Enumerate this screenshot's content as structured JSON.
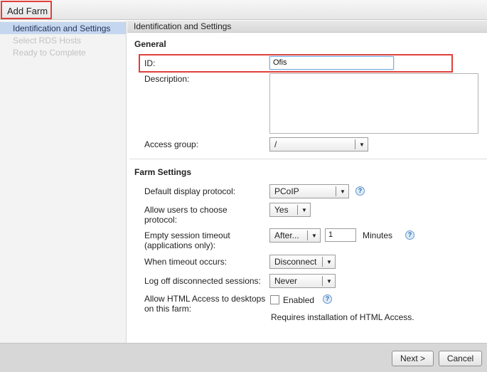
{
  "window": {
    "title": "Add Farm"
  },
  "sidebar": {
    "steps": [
      {
        "label": "Identification and Settings"
      },
      {
        "label": "Select RDS Hosts"
      },
      {
        "label": "Ready to Complete"
      }
    ]
  },
  "panel": {
    "header": "Identification and Settings"
  },
  "general": {
    "title": "General",
    "id_label": "ID:",
    "id_value": "Ofis",
    "description_label": "Description:",
    "access_group_label": "Access group:",
    "access_group_value": "/"
  },
  "farm_settings": {
    "title": "Farm Settings",
    "display_protocol_label": "Default display protocol:",
    "display_protocol_value": "PCoIP",
    "allow_choose_label_line1": "Allow users to choose",
    "allow_choose_label_line2": "protocol:",
    "allow_choose_value": "Yes",
    "empty_timeout_label_line1": "Empty session timeout",
    "empty_timeout_label_line2": "(applications only):",
    "empty_timeout_mode": "After...",
    "empty_timeout_value": "1",
    "empty_timeout_unit": "Minutes",
    "when_timeout_label": "When timeout occurs:",
    "when_timeout_value": "Disconnect",
    "logoff_label": "Log off disconnected sessions:",
    "logoff_value": "Never",
    "html_access_label_line1": "Allow HTML Access to desktops",
    "html_access_label_line2": "on this farm:",
    "html_access_checkbox_label": "Enabled",
    "html_access_checked": false,
    "html_access_note": "Requires installation of HTML Access."
  },
  "footer": {
    "next_label": "Next >",
    "cancel_label": "Cancel"
  },
  "icons": {
    "help": "?",
    "dropdown_arrow": "▼"
  },
  "colors": {
    "highlight_red": "#e0403a",
    "selected_step": "#c5d6ef",
    "help_blue": "#2a6aa8"
  }
}
